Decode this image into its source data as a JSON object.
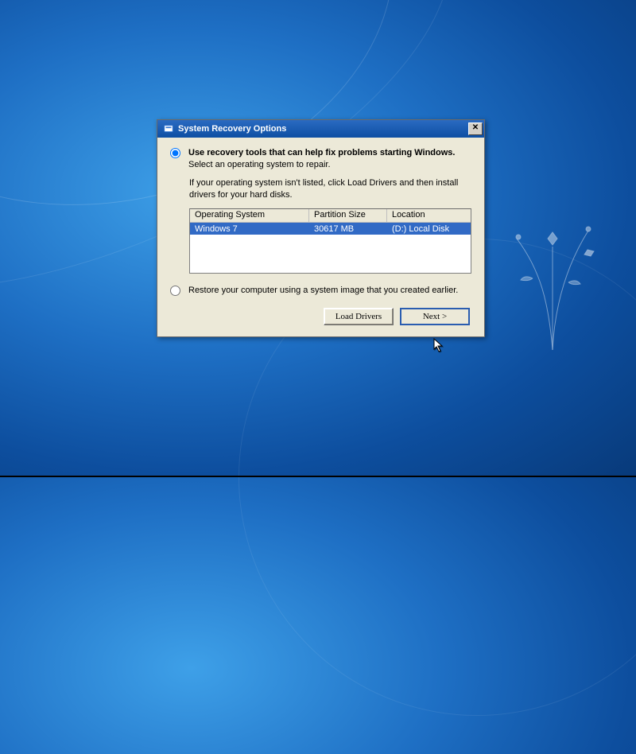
{
  "dialog": {
    "title": "System Recovery Options",
    "option1": {
      "line1_bold": "Use recovery tools that can help fix problems starting Windows.",
      "line1_tail": " Select an operating system to repair.",
      "line2": "If your operating system isn't listed, click Load Drivers and then install drivers for your hard disks.",
      "selected": true
    },
    "table": {
      "headers": {
        "os": "Operating System",
        "size": "Partition Size",
        "loc": "Location"
      },
      "rows": [
        {
          "os": "Windows 7",
          "size": "30617 MB",
          "loc": "(D:) Local Disk",
          "selected": true
        }
      ]
    },
    "option2": {
      "text": "Restore your computer using a system image that you created earlier.",
      "selected": false
    },
    "buttons": {
      "load_drivers": "Load Drivers",
      "next": "Next >"
    }
  }
}
